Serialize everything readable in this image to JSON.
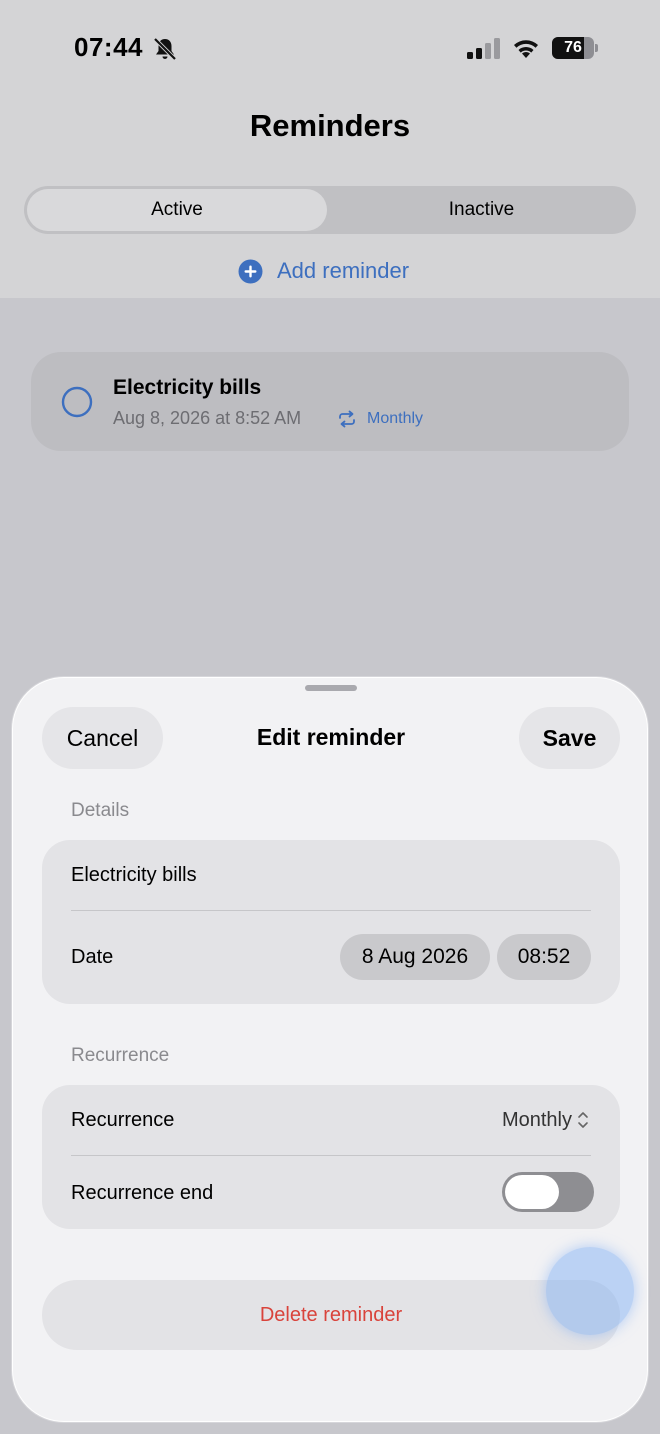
{
  "status_bar": {
    "time": "07:44",
    "battery": "76",
    "battery_level": 0.76
  },
  "header": {
    "title": "Reminders",
    "tabs": [
      {
        "label": "Active",
        "selected": true
      },
      {
        "label": "Inactive",
        "selected": false
      }
    ],
    "add_label": "Add reminder"
  },
  "reminders": [
    {
      "title": "Electricity bills",
      "date": "Aug 8, 2026 at 8:52 AM",
      "recurrence": "Monthly"
    }
  ],
  "sheet": {
    "cancel_label": "Cancel",
    "title": "Edit reminder",
    "save_label": "Save",
    "details_section": "Details",
    "name_value": "Electricity bills",
    "date_label": "Date",
    "date_value": "8 Aug 2026",
    "time_value": "08:52",
    "recurrence_section": "Recurrence",
    "recurrence_label": "Recurrence",
    "recurrence_value": "Monthly",
    "recurrence_end_label": "Recurrence end",
    "recurrence_end_on": false,
    "delete_label": "Delete reminder"
  },
  "colors": {
    "accent": "#3d6fbf",
    "destructive": "#d9433b"
  }
}
